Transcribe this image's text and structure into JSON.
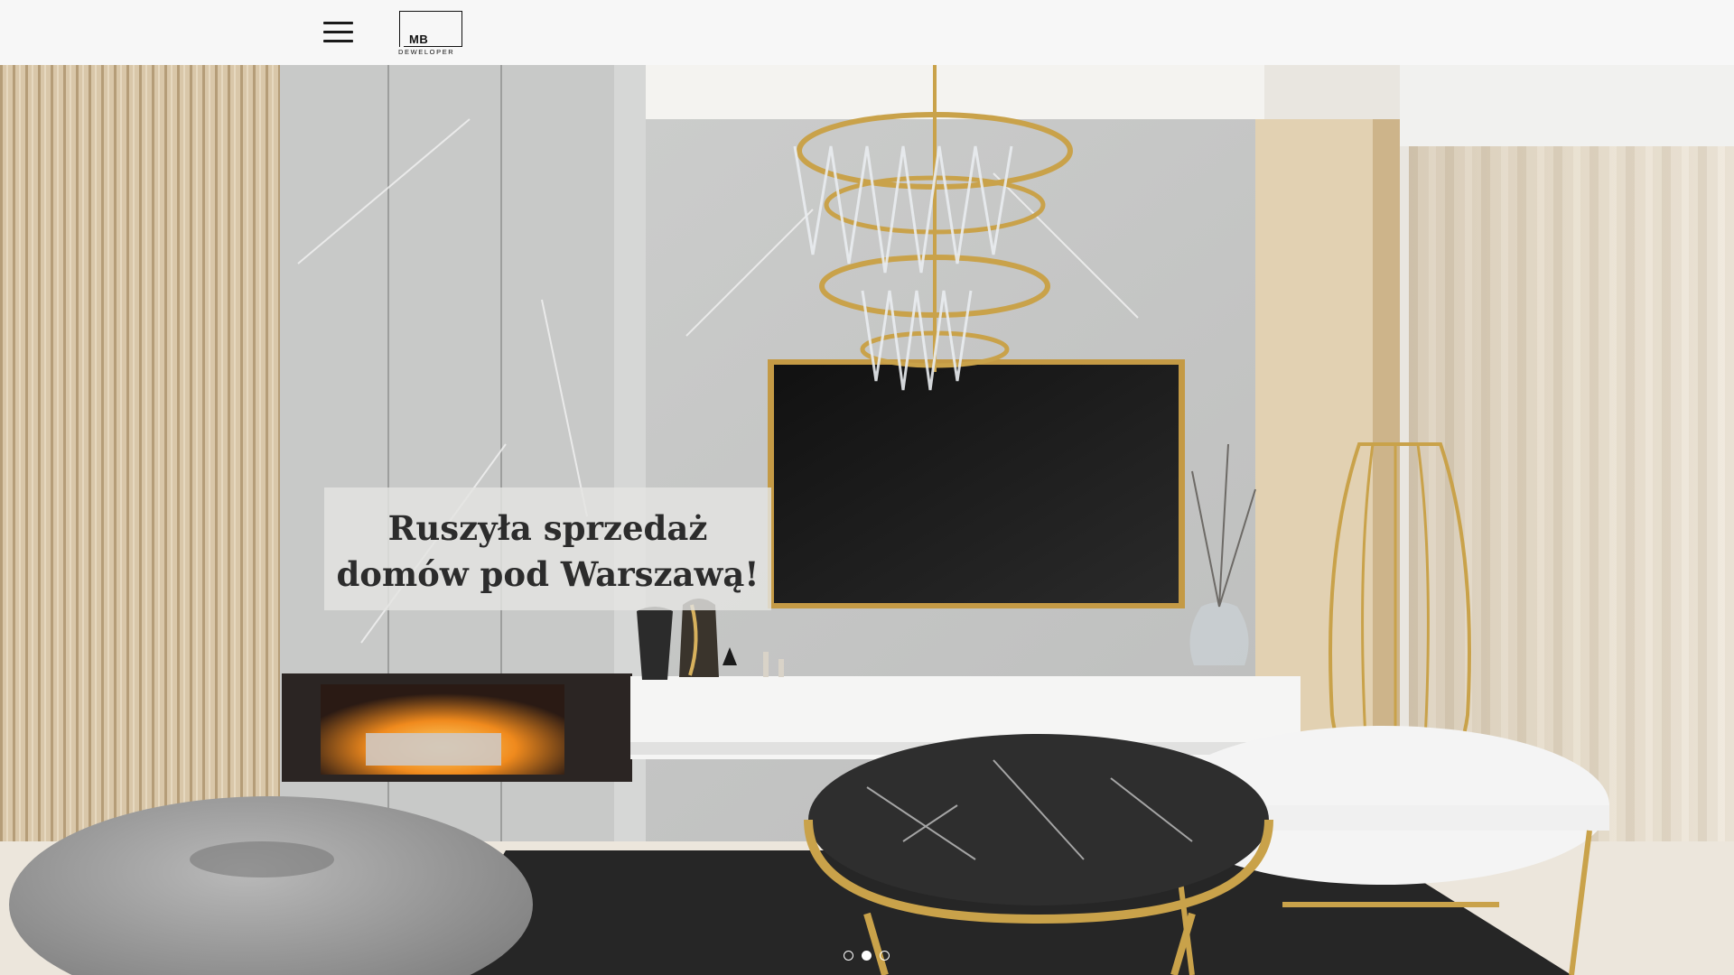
{
  "header": {
    "menu_icon": "hamburger-menu-icon",
    "logo": {
      "mark": "MB",
      "name": "DEWELOPER"
    }
  },
  "hero": {
    "headline_line1": "Ruszyła sprzedaż",
    "headline_line2": "domów pod Warszawą!",
    "slider": {
      "total_slides": 3,
      "active_index": 1
    }
  },
  "colors": {
    "header_bg": "#f7f7f7",
    "caption_bg": "#e4e4e2",
    "caption_text": "#2c2c2c",
    "gold": "#c9a24a"
  }
}
